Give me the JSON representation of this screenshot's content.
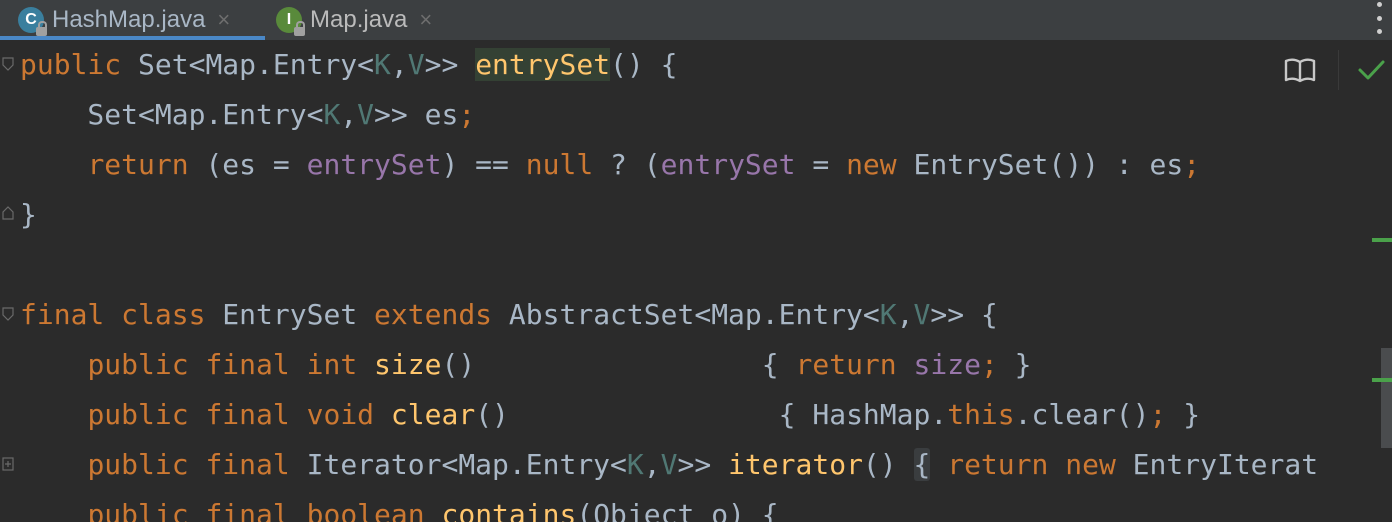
{
  "tabs": [
    {
      "label": "HashMap.java",
      "icon": "C",
      "active": true,
      "close": "×"
    },
    {
      "label": "Map.java",
      "icon": "I",
      "active": false,
      "close": "×"
    }
  ],
  "colors": {
    "keyword": "#cc7832",
    "function": "#ffc66d",
    "field": "#9876aa",
    "type_param": "#507874",
    "text": "#a9b7c6",
    "background": "#2b2b2b"
  },
  "code": {
    "l1": {
      "t1": "public",
      "t2": " Set<Map.Entry<",
      "t3": "K",
      "t4": ",",
      "t5": "V",
      "t6": ">> ",
      "t7": "entrySet",
      "t8": "() {"
    },
    "l2": {
      "t1": "    Set<Map.Entry<",
      "t2": "K",
      "t3": ",",
      "t4": "V",
      "t5": ">> es",
      "t6": ";"
    },
    "l3": {
      "t1": "    ",
      "t2": "return",
      "t3": " (es = ",
      "t4": "entrySet",
      "t5": ") == ",
      "t6": "null",
      "t7": " ? (",
      "t8": "entrySet",
      "t9": " = ",
      "t10": "new",
      "t11": " EntrySet()) : es",
      "t12": ";"
    },
    "l4": {
      "t1": "}"
    },
    "l6": {
      "t1": "final",
      "t2": " ",
      "t3": "class",
      "t4": " EntrySet ",
      "t5": "extends",
      "t6": " AbstractSet<Map.Entry<",
      "t7": "K",
      "t8": ",",
      "t9": "V",
      "t10": ">> {"
    },
    "l7": {
      "t1": "    ",
      "t2": "public",
      "t3": " ",
      "t4": "final",
      "t5": " ",
      "t6": "int",
      "t7": " ",
      "t8": "size",
      "t9": "()                 { ",
      "t10": "return",
      "t11": " ",
      "t12": "size",
      "t13": ";",
      "t14": " }"
    },
    "l8": {
      "t1": "    ",
      "t2": "public",
      "t3": " ",
      "t4": "final",
      "t5": " ",
      "t6": "void",
      "t7": " ",
      "t8": "clear",
      "t9": "()                { HashMap.",
      "t10": "this",
      "t11": ".clear()",
      "t12": ";",
      "t13": " }"
    },
    "l9": {
      "t1": "    ",
      "t2": "public",
      "t3": " ",
      "t4": "final",
      "t5": " Iterator<Map.Entry<",
      "t6": "K",
      "t7": ",",
      "t8": "V",
      "t9": ">> ",
      "t10": "iterator",
      "t11": "() ",
      "t12": "{",
      "t13": " ",
      "t14": "return",
      "t15": " ",
      "t16": "new",
      "t17": " EntryIterat"
    },
    "l10": {
      "t1": "    ",
      "t2": "public",
      "t3": " ",
      "t4": "final",
      "t5": " ",
      "t6": "boolean",
      "t7": " ",
      "t8": "contains",
      "t9": "(Object o) {"
    }
  }
}
